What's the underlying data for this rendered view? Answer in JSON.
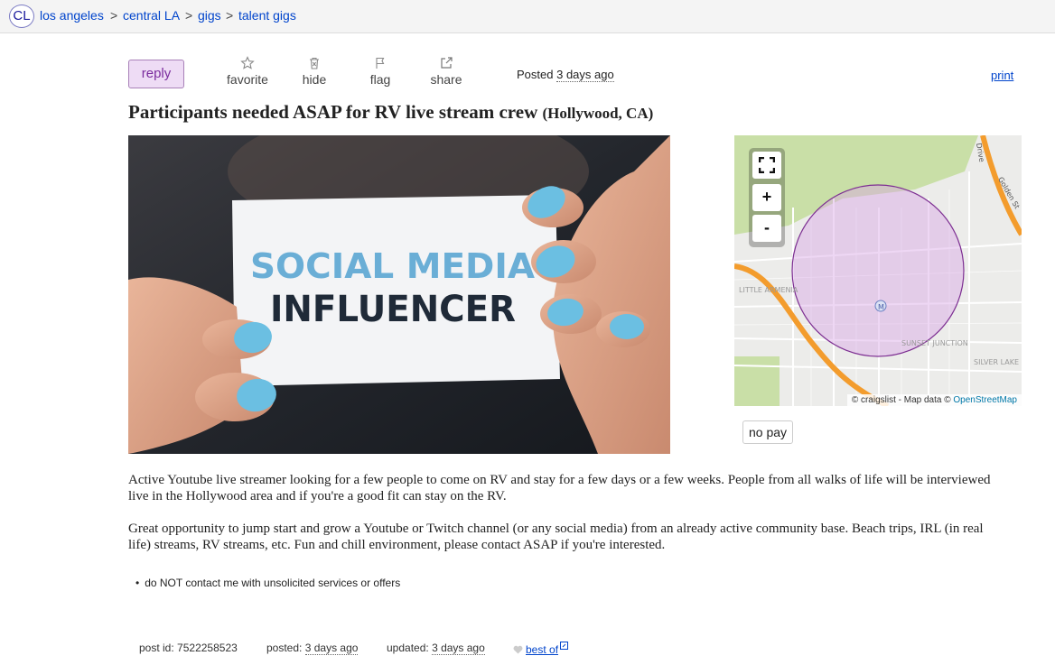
{
  "breadcrumb": {
    "logo": "CL",
    "items": [
      "los angeles",
      "central LA",
      "gigs",
      "talent gigs"
    ],
    "separator": ">"
  },
  "actions": {
    "reply": "reply",
    "favorite": "favorite",
    "hide": "hide",
    "flag": "flag",
    "share": "share",
    "posted_label": "Posted",
    "posted_value": "3 days ago",
    "print": "print"
  },
  "post": {
    "title": "Participants needed ASAP for RV live stream crew",
    "location": "(Hollywood, CA)",
    "image_text": [
      "SOCIAL MEDIA",
      "INFLUENCER"
    ],
    "compensation": "no pay",
    "paragraphs": [
      "Active Youtube live streamer looking for a few people to come on RV and stay for a few days or a few weeks. People from all walks of life will be interviewed live in the Hollywood area and if you're a good fit can stay on the RV.",
      "Great opportunity to jump start and grow a Youtube or Twitch channel (or any social media) from an already active community base. Beach trips, IRL (in real life) streams, RV streams, etc. Fun and chill environment, please contact ASAP if you're interested."
    ],
    "notice": "do NOT contact me with unsolicited services or offers"
  },
  "map": {
    "credit_prefix": "© craigslist - Map data ©",
    "credit_osm": "OpenStreetMap",
    "labels": [
      "LITTLE ARMENIA",
      "SUNSET JUNCTION",
      "SILVER LAKE",
      "Golden St",
      "Drive"
    ],
    "metro_marker": "M",
    "zoom_in": "+",
    "zoom_out": "-",
    "colors": {
      "radius": "#d9a6e6",
      "freeway": "#f39c2d",
      "park": "#c9dfa7"
    }
  },
  "footer": {
    "post_id_label": "post id:",
    "post_id": "7522258523",
    "posted_label": "posted:",
    "posted_value": "3 days ago",
    "updated_label": "updated:",
    "updated_value": "3 days ago",
    "best_of": "best of"
  }
}
